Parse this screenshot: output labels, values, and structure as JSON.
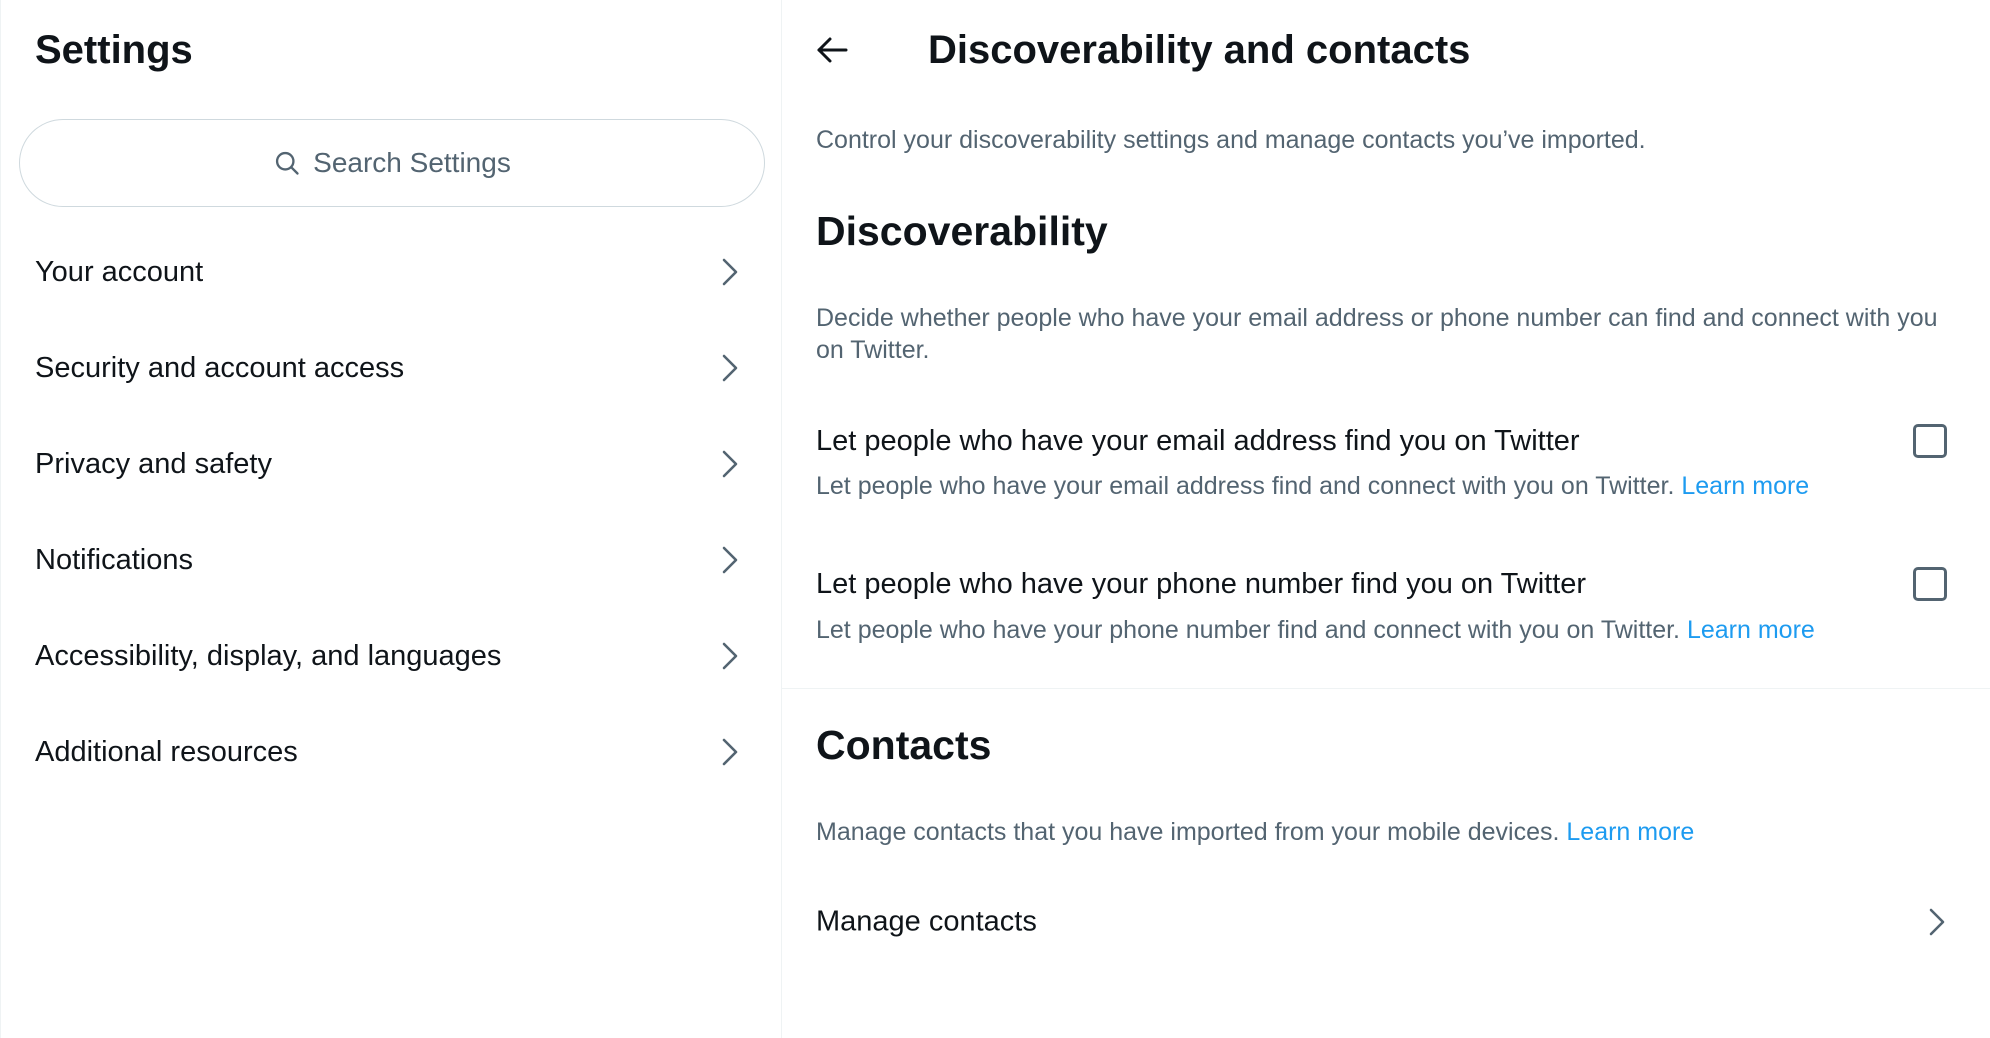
{
  "sidebar": {
    "title": "Settings",
    "search_placeholder": "Search Settings",
    "items": [
      {
        "label": "Your account",
        "icon": "chevron-right-icon"
      },
      {
        "label": "Security and account access",
        "icon": "chevron-right-icon"
      },
      {
        "label": "Privacy and safety",
        "icon": "chevron-right-icon"
      },
      {
        "label": "Notifications",
        "icon": "chevron-right-icon"
      },
      {
        "label": "Accessibility, display, and languages",
        "icon": "chevron-right-icon"
      },
      {
        "label": "Additional resources",
        "icon": "chevron-right-icon"
      }
    ]
  },
  "detail": {
    "back_icon": "arrow-left-icon",
    "title": "Discoverability and contacts",
    "intro": "Control your discoverability settings and manage contacts you’ve imported.",
    "discoverability": {
      "heading": "Discoverability",
      "description": "Decide whether people who have your email address or phone number can find and connect with you on Twitter.",
      "settings": [
        {
          "title": "Let people who have your email address find you on Twitter",
          "subtitle": "Let people who have your email address find and connect with you on Twitter.",
          "link": "Learn more",
          "checked": false
        },
        {
          "title": "Let people who have your phone number find you on Twitter",
          "subtitle": "Let people who have your phone number find and connect with you on Twitter.",
          "link": "Learn more",
          "checked": false
        }
      ]
    },
    "contacts": {
      "heading": "Contacts",
      "description": "Manage contacts that you have imported from your mobile devices.",
      "link": "Learn more",
      "manage_label": "Manage contacts"
    }
  },
  "colors": {
    "text_primary": "#0f1419",
    "text_secondary": "#536471",
    "link": "#1d9bf0",
    "border": "#cfd9de",
    "divider": "#eff3f4"
  }
}
